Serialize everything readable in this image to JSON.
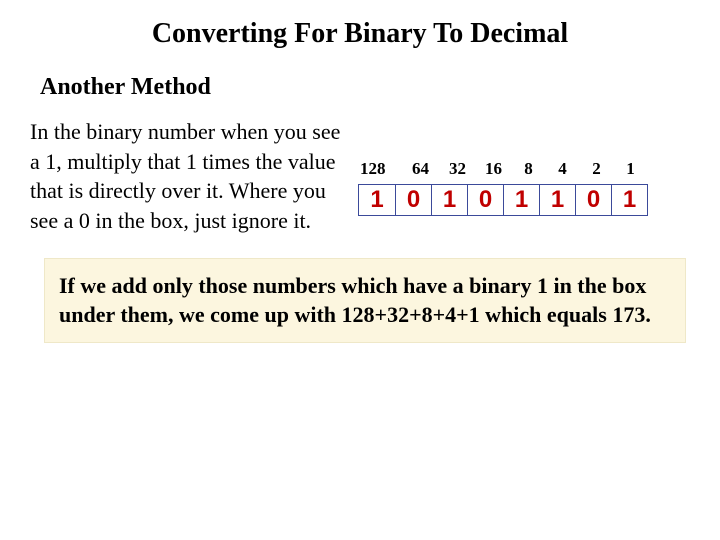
{
  "title": "Converting For Binary To Decimal",
  "subtitle": "Another Method",
  "paragraph": "In the binary number when you see a 1, multiply that 1 times the value that is directly over it. Where you see a 0 in the box, just ignore it.",
  "places": [
    "128",
    "64",
    "32",
    "16",
    "8",
    "4",
    "2",
    "1"
  ],
  "digits": [
    "1",
    "0",
    "1",
    "0",
    "1",
    "1",
    "0",
    "1"
  ],
  "summary": "If we add only those numbers which have a binary 1 in the box under them, we come up with 128+32+8+4+1 which equals 173.",
  "chart_data": {
    "type": "table",
    "title": "Binary place-value mapping",
    "columns": [
      "place_value",
      "binary_digit"
    ],
    "rows": [
      {
        "place_value": 128,
        "binary_digit": 1
      },
      {
        "place_value": 64,
        "binary_digit": 0
      },
      {
        "place_value": 32,
        "binary_digit": 1
      },
      {
        "place_value": 16,
        "binary_digit": 0
      },
      {
        "place_value": 8,
        "binary_digit": 1
      },
      {
        "place_value": 4,
        "binary_digit": 1
      },
      {
        "place_value": 2,
        "binary_digit": 0
      },
      {
        "place_value": 1,
        "binary_digit": 1
      }
    ],
    "sum_expression": "128+32+8+4+1",
    "result": 173
  }
}
